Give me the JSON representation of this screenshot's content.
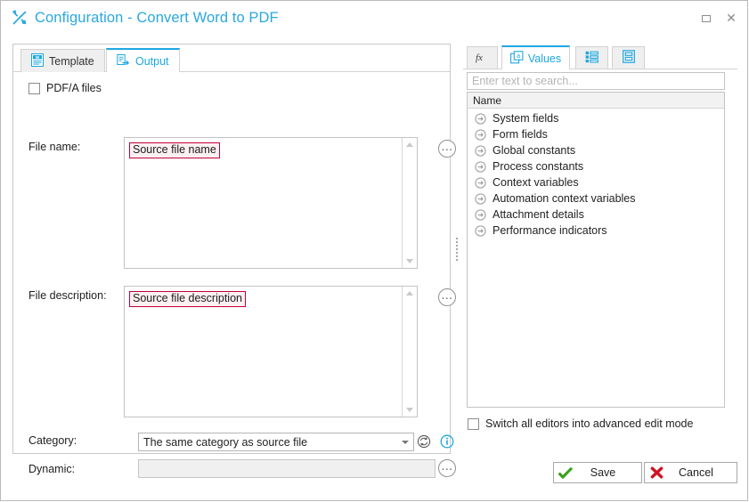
{
  "window": {
    "title": "Configuration - Convert Word to PDF",
    "title_icon": "tools-icon",
    "restore_label": "Restore",
    "close_label": "Close",
    "accent_color": "#29a8e0",
    "token_border_color": "#c2003b"
  },
  "left": {
    "tabs": [
      {
        "label": "Template",
        "icon": "word-document-icon",
        "active": false
      },
      {
        "label": "Output",
        "icon": "pdf-export-icon",
        "active": true
      }
    ],
    "pdfa_checkbox": {
      "label": "PDF/A files",
      "checked": false
    },
    "file_name": {
      "label": "File name:",
      "token": "Source file name",
      "ellipsis_label": "..."
    },
    "file_description": {
      "label": "File description:",
      "token": "Source file description",
      "ellipsis_label": "..."
    },
    "category": {
      "label": "Category:",
      "value": "The same category as source file",
      "refresh_icon": "refresh-icon",
      "info_icon": "info-icon"
    },
    "dynamic": {
      "label": "Dynamic:",
      "value": "",
      "ellipsis_label": "...",
      "disabled": true
    }
  },
  "right": {
    "tabs": [
      {
        "label": "",
        "icon": "function-fx-icon",
        "active": false
      },
      {
        "label": "Values",
        "icon": "values-a-icon",
        "active": true
      },
      {
        "label": "",
        "icon": "list-items-icon",
        "active": false
      },
      {
        "label": "",
        "icon": "form-layout-icon",
        "active": false
      }
    ],
    "search": {
      "placeholder": "Enter text to search...",
      "value": ""
    },
    "tree_header": "Name",
    "tree_items": [
      {
        "label": "System fields",
        "icon": "arrow-circle-icon"
      },
      {
        "label": "Form fields",
        "icon": "arrow-circle-icon"
      },
      {
        "label": "Global constants",
        "icon": "arrow-circle-icon"
      },
      {
        "label": "Process constants",
        "icon": "arrow-circle-icon"
      },
      {
        "label": "Context variables",
        "icon": "arrow-circle-icon"
      },
      {
        "label": "Automation context variables",
        "icon": "arrow-circle-icon"
      },
      {
        "label": "Attachment details",
        "icon": "arrow-circle-icon"
      },
      {
        "label": "Performance indicators",
        "icon": "arrow-circle-icon"
      }
    ],
    "advanced_checkbox": {
      "label": "Switch all editors into advanced edit mode",
      "checked": false
    }
  },
  "footer": {
    "save": {
      "label": "Save",
      "icon": "green-check-icon"
    },
    "cancel": {
      "label": "Cancel",
      "icon": "red-x-icon"
    }
  }
}
